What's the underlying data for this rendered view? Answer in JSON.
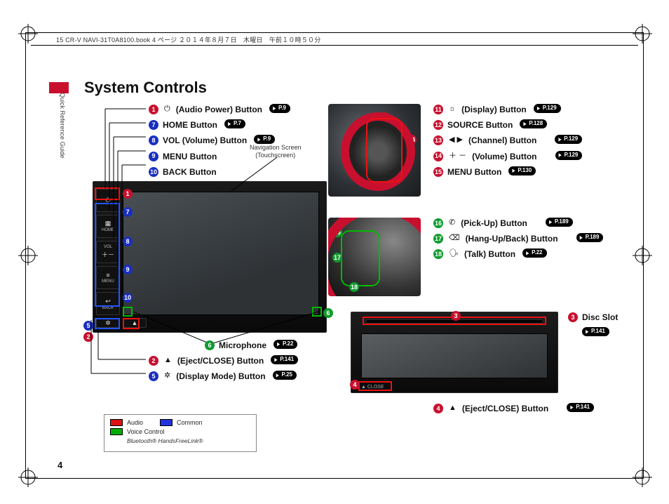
{
  "header": "15 CR-V NAVI-31T0A8100.book  4 ページ  ２０１４年８月７日　木曜日　午前１０時５０分",
  "side_label": "Quick Reference Guide",
  "title": "System Controls",
  "page_number": "4",
  "nav_caption_line1": "Navigation Screen",
  "nav_caption_line2": "(Touchscreen)",
  "nav_buttons": {
    "home": "HOME",
    "vol": "VOL",
    "menu": "MENU",
    "back": "BACK",
    "close": "▲ CLOSE"
  },
  "legend": {
    "audio": "Audio",
    "common": "Common",
    "voice": "Voice Control",
    "bt": "Bluetooth® HandsFreeLink®"
  },
  "items": {
    "i1": {
      "num": "1",
      "color": "red",
      "icon": "⏻",
      "label": "(Audio Power) Button",
      "page": "P.9"
    },
    "i7": {
      "num": "7",
      "color": "blue",
      "icon": "",
      "label": "HOME Button",
      "page": "P.7"
    },
    "i8": {
      "num": "8",
      "color": "blue",
      "icon": "",
      "label": "VOL (Volume) Button",
      "page": "P.9"
    },
    "i9": {
      "num": "9",
      "color": "blue",
      "icon": "",
      "label": "MENU Button",
      "page": ""
    },
    "i10": {
      "num": "10",
      "color": "blue",
      "icon": "",
      "label": "BACK Button",
      "page": ""
    },
    "i6": {
      "num": "6",
      "color": "green",
      "icon": "",
      "label": "Microphone",
      "page": "P.22"
    },
    "i2": {
      "num": "2",
      "color": "red",
      "icon": "▲",
      "label": "(Eject/CLOSE) Button",
      "page": "P.141"
    },
    "i5": {
      "num": "5",
      "color": "blue",
      "icon": "✲",
      "label": "(Display Mode) Button",
      "page": "P.25"
    },
    "i11": {
      "num": "11",
      "color": "red",
      "icon": "☼",
      "label": "(Display) Button",
      "page": "P.129"
    },
    "i12": {
      "num": "12",
      "color": "red",
      "icon": "",
      "label": "SOURCE Button",
      "page": "P.128"
    },
    "i13": {
      "num": "13",
      "color": "red",
      "icon": "◀ ▶",
      "label": "(Channel) Button",
      "page": "P.129"
    },
    "i14": {
      "num": "14",
      "color": "red",
      "icon": "＋ －",
      "label": "(Volume) Button",
      "page": "P.129"
    },
    "i15": {
      "num": "15",
      "color": "red",
      "icon": "",
      "label": "MENU Button",
      "page": "P.130"
    },
    "i16": {
      "num": "16",
      "color": "green",
      "icon": "✆",
      "label": "(Pick-Up) Button",
      "page": "P.189"
    },
    "i17": {
      "num": "17",
      "color": "green",
      "icon": "⌫",
      "label": "(Hang-Up/Back) Button",
      "page": "P.189"
    },
    "i18": {
      "num": "18",
      "color": "green",
      "icon": "🗣",
      "label": "(Talk) Button",
      "page": "P.22"
    },
    "i3": {
      "num": "3",
      "color": "red",
      "icon": "",
      "label": "Disc Slot",
      "page": "P.141"
    },
    "i4": {
      "num": "4",
      "color": "red",
      "icon": "▲",
      "label": "(Eject/CLOSE) Button",
      "page": "P.141"
    }
  }
}
